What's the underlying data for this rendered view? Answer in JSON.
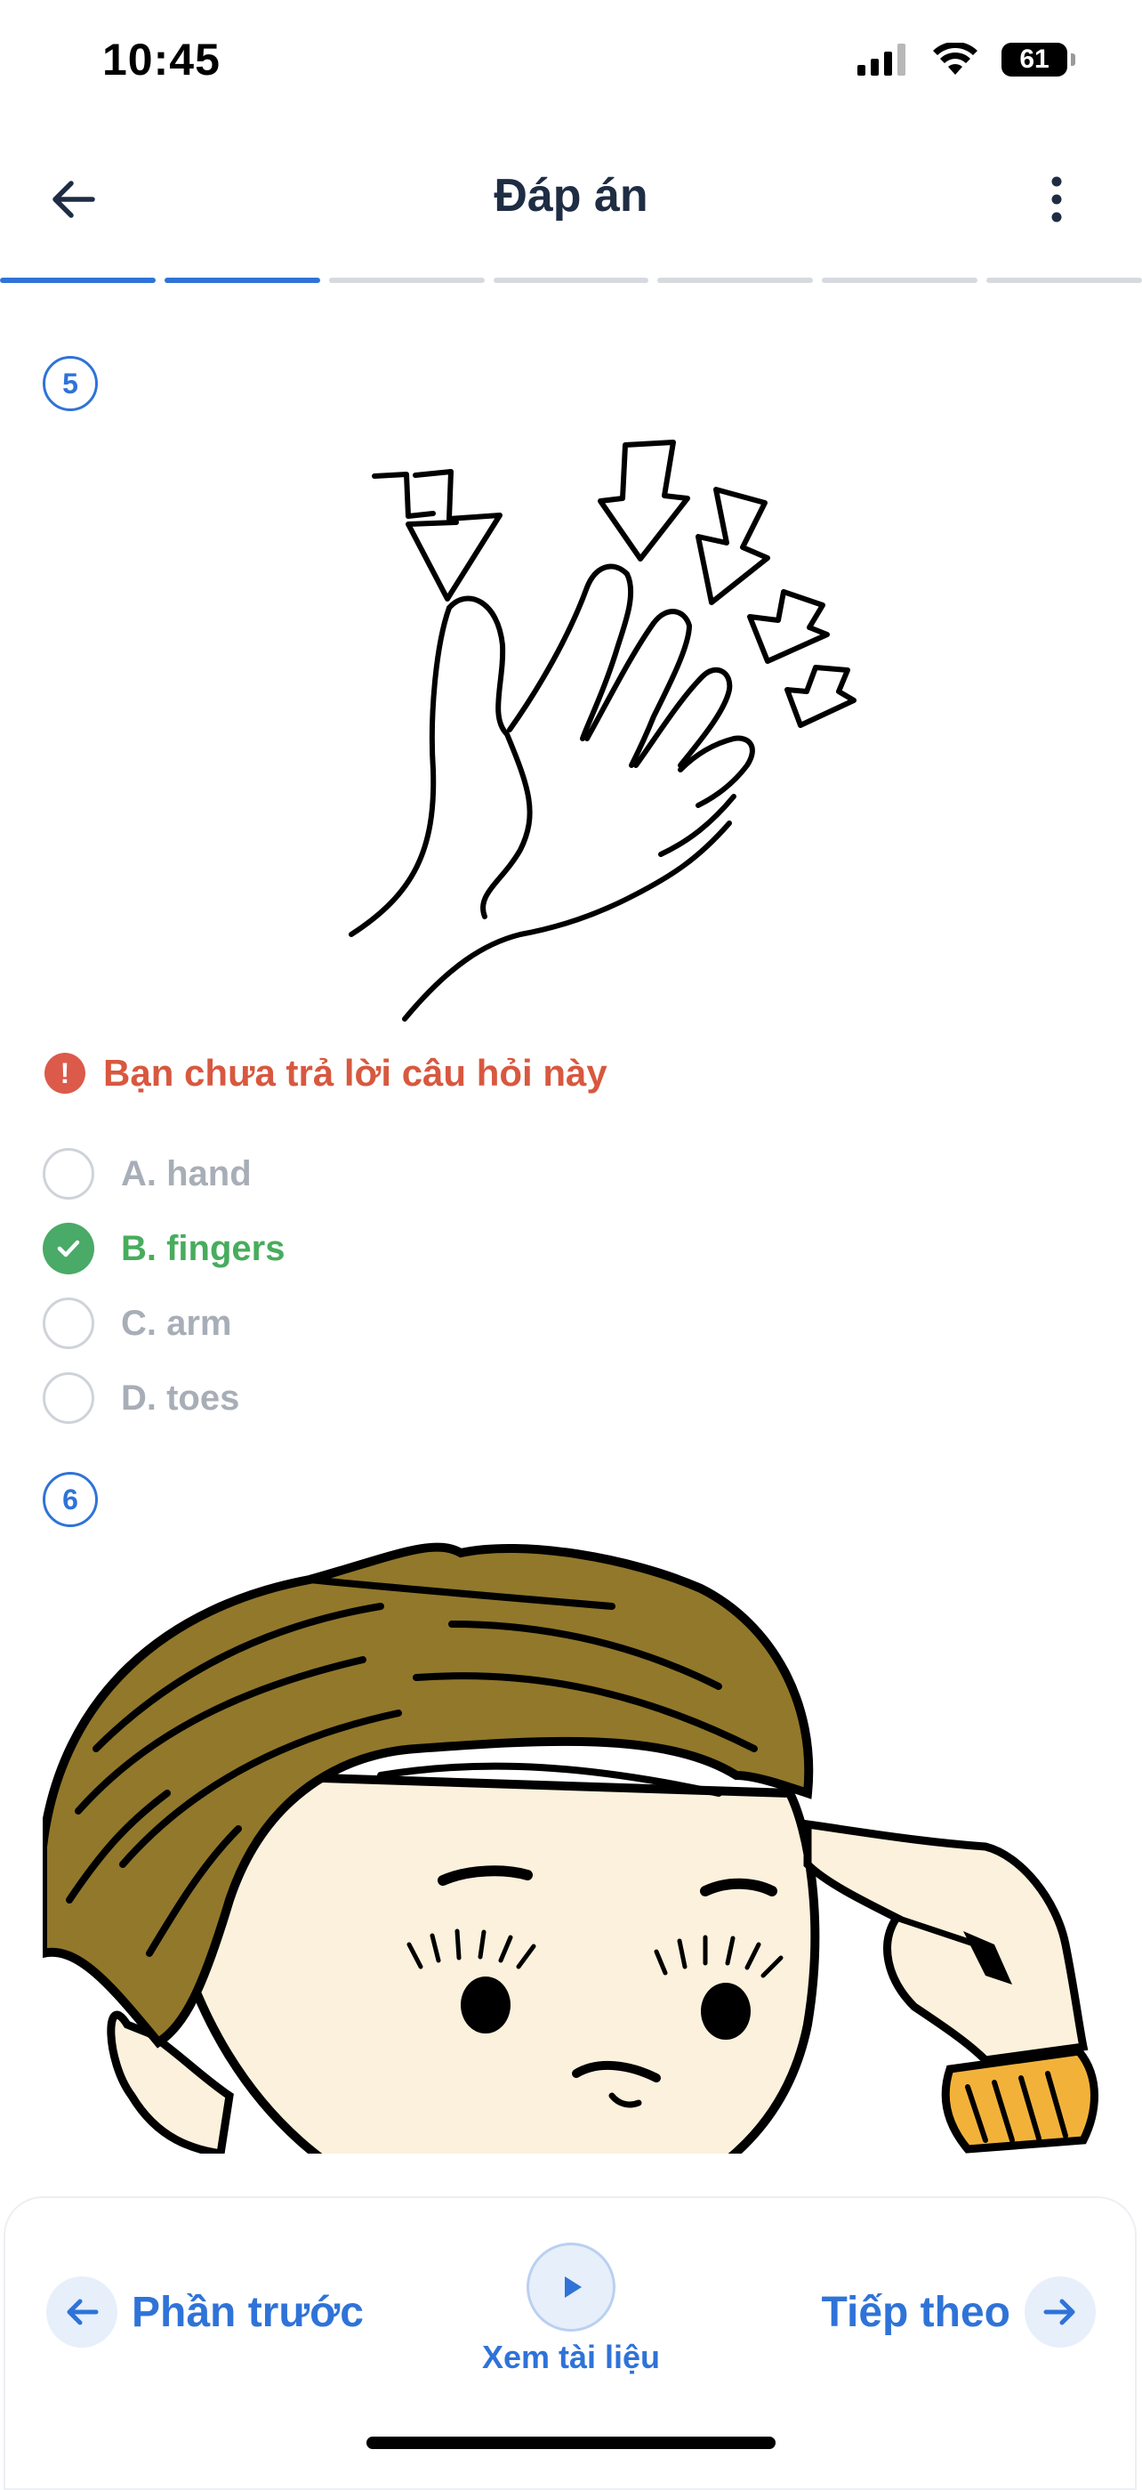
{
  "status_bar": {
    "time": "10:45",
    "battery": "61"
  },
  "header": {
    "title": "Đáp án"
  },
  "progress": {
    "total_segments": 7,
    "completed_segments": 2
  },
  "questions": [
    {
      "number": "5",
      "warning": "Bạn chưa trả lời câu hỏi này",
      "options": [
        {
          "label": "A. hand",
          "state": "unselected"
        },
        {
          "label": "B. fingers",
          "state": "correct"
        },
        {
          "label": "C. arm",
          "state": "unselected"
        },
        {
          "label": "D. toes",
          "state": "unselected"
        }
      ]
    },
    {
      "number": "6"
    }
  ],
  "bottom_nav": {
    "prev_label": "Phần trước",
    "doc_label": "Xem tài liệu",
    "next_label": "Tiếp theo"
  },
  "colors": {
    "accent": "#2f73d8",
    "correct": "#4aaa67",
    "warning": "#dc5a4a",
    "muted": "#a8aeb7"
  }
}
